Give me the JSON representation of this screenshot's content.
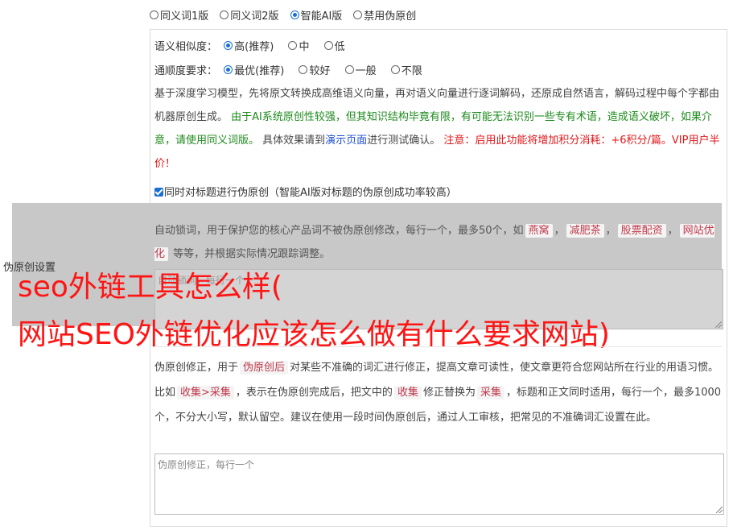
{
  "mode_options": [
    {
      "label": "同义词1版",
      "selected": false
    },
    {
      "label": "同义词2版",
      "selected": false
    },
    {
      "label": "智能AI版",
      "selected": true
    },
    {
      "label": "禁用伪原创",
      "selected": false
    }
  ],
  "similarity": {
    "label": "语义相似度：",
    "options": [
      {
        "label": "高(推荐)",
        "selected": true
      },
      {
        "label": "中",
        "selected": false
      },
      {
        "label": "低",
        "selected": false
      }
    ]
  },
  "fluency": {
    "label": "通顺度要求：",
    "options": [
      {
        "label": "最优(推荐)",
        "selected": true
      },
      {
        "label": "较好",
        "selected": false
      },
      {
        "label": "一般",
        "selected": false
      },
      {
        "label": "不限",
        "selected": false
      }
    ]
  },
  "description": {
    "part1": "基于深度学习模型，先将原文转换成高维语义向量，再对语义向量进行逐词解码，还原成自然语言，解码过程中每个字都由机器原创生成。",
    "part2_green": "由于AI系统原创性较强，但其知识结构毕竟有限，有可能无法识别一些专有术语，造成语义破坏，如果介意，请使用同义词版。",
    "part3": "具体效果请到",
    "part3_link": "演示页面",
    "part3_end": "进行测试确认。",
    "part4_red": "注意：启用此功能将增加积分消耗：+6积分/篇。VIP用户半价！"
  },
  "title_checkbox": {
    "label": "同时对标题进行伪原创（智能AI版对标题的伪原创成功率较高）",
    "checked": true
  },
  "lock_words": {
    "section_label": "伪原创设置",
    "text_start": "自动锁词，用于保护您的核心产品词不被伪原创修改，每行一个，最多50个，如",
    "examples": [
      "燕窝",
      "减肥茶",
      "股票配资",
      "网站优化"
    ],
    "text_end": "等等，并根据实际情况跟踪调整。",
    "placeholder": "自动锁词，每行一个"
  },
  "overlay": {
    "line1": "seo外链工具怎么样(",
    "line2": "网站SEO外链优化应该怎么做有什么要求网站)"
  },
  "correction": {
    "text_a": "伪原创修正，用于",
    "tag_a": "伪原创后",
    "text_b": "对某些不准确的词汇进行修正，提高文章可读性，使文章更符合您网站所在行业的用语习惯。比如",
    "tag_b": "收集>采集",
    "text_c": "，表示在伪原创完成后，把文中的",
    "tag_c": "收集",
    "text_d": "修正替换为",
    "tag_d": "采集",
    "text_e": "，标题和正文同时适用，每行一个，最多1000个，不分大小写，默认留空。建议在使用一段时间伪原创后，通过人工审核，把常见的不准确词汇设置在此。",
    "placeholder": "伪原创修正，每行一个"
  }
}
